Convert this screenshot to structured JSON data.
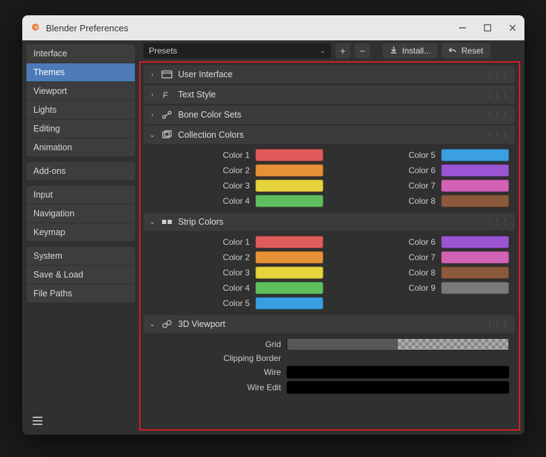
{
  "titlebar": {
    "title": "Blender Preferences"
  },
  "sidebar": {
    "groups": [
      {
        "items": [
          "Interface",
          "Themes",
          "Viewport",
          "Lights",
          "Editing",
          "Animation"
        ],
        "active": "Themes"
      },
      {
        "items": [
          "Add-ons"
        ]
      },
      {
        "items": [
          "Input",
          "Navigation",
          "Keymap"
        ]
      },
      {
        "items": [
          "System",
          "Save & Load",
          "File Paths"
        ]
      }
    ]
  },
  "toolbar": {
    "presets_label": "Presets",
    "install_label": "Install...",
    "reset_label": "Reset"
  },
  "sections": {
    "user_interface": {
      "label": "User Interface",
      "expanded": false
    },
    "text_style": {
      "label": "Text Style",
      "expanded": false
    },
    "bone_colors": {
      "label": "Bone Color Sets",
      "expanded": false
    },
    "collection_colors": {
      "label": "Collection Colors",
      "expanded": true,
      "left": [
        {
          "label": "Color 1",
          "hex": "#e25b5b"
        },
        {
          "label": "Color 2",
          "hex": "#e69138"
        },
        {
          "label": "Color 3",
          "hex": "#e6d23a"
        },
        {
          "label": "Color 4",
          "hex": "#5fbf5f"
        }
      ],
      "right": [
        {
          "label": "Color 5",
          "hex": "#3a9fe0"
        },
        {
          "label": "Color 6",
          "hex": "#9b55d3"
        },
        {
          "label": "Color 7",
          "hex": "#d162b4"
        },
        {
          "label": "Color 8",
          "hex": "#8b5a3c"
        }
      ]
    },
    "strip_colors": {
      "label": "Strip Colors",
      "expanded": true,
      "left": [
        {
          "label": "Color 1",
          "hex": "#e25b5b"
        },
        {
          "label": "Color 2",
          "hex": "#e69138"
        },
        {
          "label": "Color 3",
          "hex": "#e6d23a"
        },
        {
          "label": "Color 4",
          "hex": "#5fbf5f"
        },
        {
          "label": "Color 5",
          "hex": "#3a9fe0"
        }
      ],
      "right": [
        {
          "label": "Color 6",
          "hex": "#9b55d3"
        },
        {
          "label": "Color 7",
          "hex": "#d162b4"
        },
        {
          "label": "Color 8",
          "hex": "#8b5a3c"
        },
        {
          "label": "Color 9",
          "hex": "#7a7a7a"
        }
      ]
    },
    "viewport_3d": {
      "label": "3D Viewport",
      "expanded": true,
      "rows": [
        {
          "label": "Grid",
          "hex": "#565656",
          "alpha": true
        },
        {
          "label": "Clipping Border",
          "hex": null
        },
        {
          "label": "Wire",
          "hex": "#000000"
        },
        {
          "label": "Wire Edit",
          "hex": "#000000"
        }
      ]
    }
  }
}
